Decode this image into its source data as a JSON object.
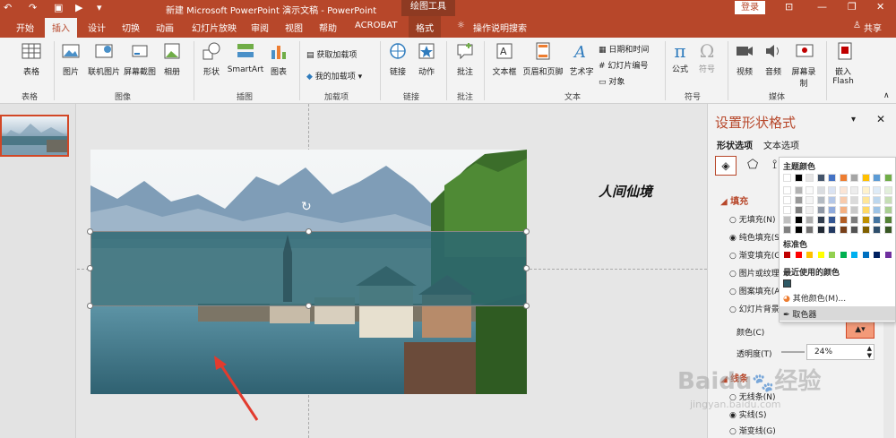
{
  "titlebar": {
    "title": "新建 Microsoft PowerPoint 演示文稿 - PowerPoint",
    "tool_context": "绘图工具",
    "login": "登录",
    "undo": "↶",
    "redo": "↷",
    "restore": "❐",
    "minimize": "—",
    "close": "✕"
  },
  "tabs": [
    {
      "label": "开始"
    },
    {
      "label": "插入"
    },
    {
      "label": "设计"
    },
    {
      "label": "切换"
    },
    {
      "label": "动画"
    },
    {
      "label": "幻灯片放映"
    },
    {
      "label": "审阅"
    },
    {
      "label": "视图"
    },
    {
      "label": "帮助"
    },
    {
      "label": "ACROBAT"
    },
    {
      "label": "格式"
    }
  ],
  "tellme": "操作说明搜索",
  "share": "共享",
  "ribbon": {
    "buttons": [
      {
        "label": "表格"
      },
      {
        "label": "图片"
      },
      {
        "label": "联机图片"
      },
      {
        "label": "屏幕截图"
      },
      {
        "label": "相册"
      },
      {
        "label": "形状"
      },
      {
        "label": "SmartArt"
      },
      {
        "label": "图表"
      },
      {
        "label": "链接"
      },
      {
        "label": "动作"
      },
      {
        "label": "批注"
      },
      {
        "label": "文本框"
      },
      {
        "label": "页眉和页脚"
      },
      {
        "label": "艺术字"
      },
      {
        "label": "公式"
      },
      {
        "label": "符号"
      },
      {
        "label": "视频"
      },
      {
        "label": "音频"
      },
      {
        "label": "屏幕录制"
      },
      {
        "label": "嵌入 Flash"
      }
    ],
    "small": {
      "get_addins": "获取加载项",
      "my_addins": "我的加载项",
      "datetime": "日期和时间",
      "slide_number": "幻灯片编号",
      "object": "对象"
    },
    "groups": {
      "tables": "表格",
      "images": "图像",
      "illustrations": "插图",
      "addins": "加载项",
      "links": "链接",
      "comments": "批注",
      "text": "文本",
      "symbols": "符号",
      "media": "媒体"
    }
  },
  "slide": {
    "calligraphy": "人间仙境"
  },
  "pane": {
    "title": "设置形状格式",
    "tab_shape": "形状选项",
    "tab_text": "文本选项",
    "section_fill": "填充",
    "section_line": "线条",
    "fill": {
      "none": "无填充(N)",
      "solid": "纯色填充(S)",
      "gradient": "渐变填充(G)",
      "picture": "图片或纹理填充(P)",
      "pattern": "图案填充(A)",
      "slide_bg": "幻灯片背景填充(B)"
    },
    "color_label": "颜色(C)",
    "transparency_label": "透明度(T)",
    "transparency_value": "24%",
    "line": {
      "none": "无线条(N)",
      "solid": "实线(S)",
      "gradient": "渐变线(G)"
    }
  },
  "color_menu": {
    "theme_title": "主题颜色",
    "standard_title": "标准色",
    "recent_title": "最近使用的颜色",
    "more_colors": "其他颜色(M)...",
    "eyedropper": "取色器",
    "theme_top": [
      "#ffffff",
      "#000000",
      "#e7e6e6",
      "#44546a",
      "#4472c4",
      "#ed7d31",
      "#a5a5a5",
      "#ffc000",
      "#5b9bd5",
      "#70ad47"
    ],
    "standard": [
      "#c00000",
      "#ff0000",
      "#ffc000",
      "#ffff00",
      "#92d050",
      "#00b050",
      "#00b0f0",
      "#0070c0",
      "#002060",
      "#7030a0"
    ],
    "recent": [
      "#2e5965"
    ]
  },
  "watermark": {
    "brand": "Baidu",
    "text": "经验",
    "url": "jingyan.baidu.com"
  }
}
